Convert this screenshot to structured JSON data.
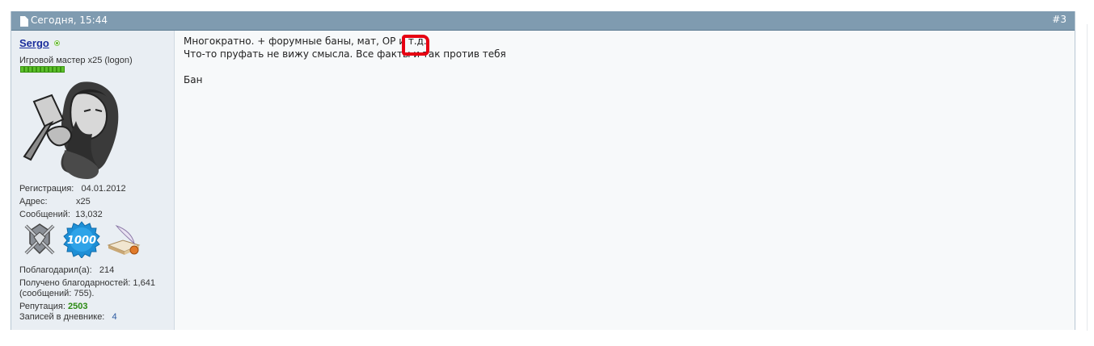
{
  "post": {
    "date": "Сегодня, 15:44",
    "number": "#3"
  },
  "user": {
    "name": "Sergo",
    "title": "Игровой мастер x25 (logon)",
    "rep_segments": 11,
    "join_label": "Регистрация:",
    "join_value": "04.01.2012",
    "address_label": "Адрес:",
    "address_value": "x25",
    "messages_label": "Сообщений:",
    "messages_value": "13,032",
    "thanked_label": "Поблагодарил(а):",
    "thanked_value": "214",
    "received_line1": "Получено благодарностей: 1,641",
    "received_line2": "(сообщений: 755).",
    "rep_label": "Репутация:",
    "rep_value": "2503",
    "diary_label": "Записей в дневнике:",
    "diary_value": "4",
    "award_1000": "1000"
  },
  "message": {
    "line1_a": "Многократно. + форумные баны, мат, ",
    "line1_b": "OP",
    "line1_c": " и т.д.",
    "line2": "Что-то пруфать не вижу смысла. Все факты и так против тебя",
    "line3": "Бан"
  },
  "colors": {
    "header": "#7f9bb0",
    "username": "#1a2d9c",
    "highlight": "#e60012",
    "reputation": "#2a8a12"
  }
}
